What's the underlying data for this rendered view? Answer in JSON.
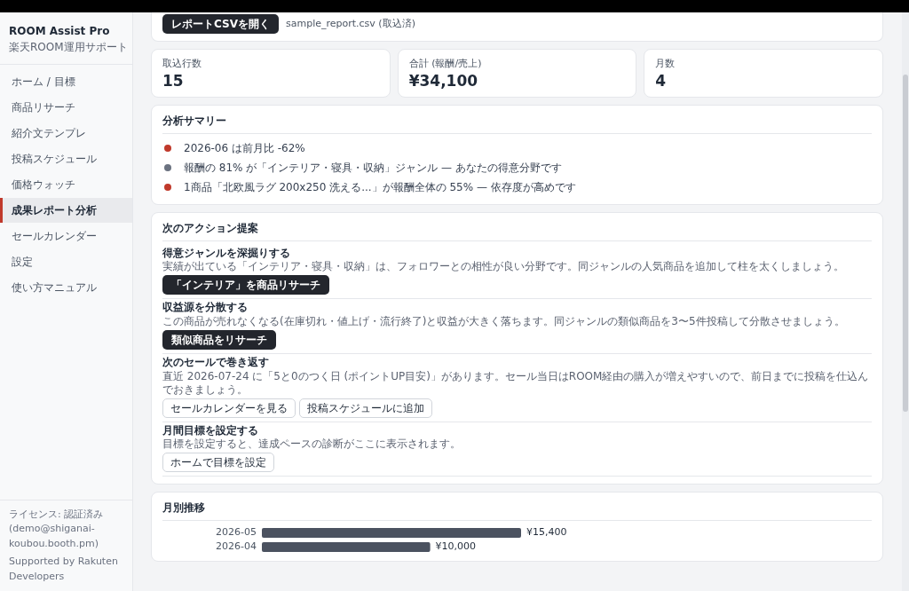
{
  "sidebar": {
    "app_title": "ROOM Assist Pro",
    "app_subtitle": "楽天ROOM運用サポート",
    "items": [
      {
        "label": "ホーム / 目標",
        "selected": false
      },
      {
        "label": "商品リサーチ",
        "selected": false
      },
      {
        "label": "紹介文テンプレ",
        "selected": false
      },
      {
        "label": "投稿スケジュール",
        "selected": false
      },
      {
        "label": "価格ウォッチ",
        "selected": false
      },
      {
        "label": "成果レポート分析",
        "selected": true
      },
      {
        "label": "セールカレンダー",
        "selected": false
      },
      {
        "label": "設定",
        "selected": false
      },
      {
        "label": "使い方マニュアル",
        "selected": false
      }
    ],
    "license": "ライセンス: 認証済み (demo@shiganai-koubou.booth.pm)",
    "credit": "Supported by Rakuten Developers"
  },
  "import_card": {
    "button": "レポートCSVを開く",
    "file": "sample_report.csv (取込済)"
  },
  "stats": [
    {
      "label": "取込行数",
      "value": "15"
    },
    {
      "label": "合計 (報酬/売上)",
      "value": "¥34,100"
    },
    {
      "label": "月数",
      "value": "4"
    }
  ],
  "summary": {
    "title": "分析サマリー",
    "items": [
      {
        "text": "2026-06 は前月比 -62%",
        "color": "#c0392b"
      },
      {
        "text": "報酬の 81% が「インテリア・寝具・収納」ジャンル — あなたの得意分野です",
        "color": "#6b7280"
      },
      {
        "text": "1商品「北欧風ラグ 200x250 洗える...」が報酬全体の 55% — 依存度が高めです",
        "color": "#c0392b"
      }
    ]
  },
  "actions": {
    "title": "次のアクション提案",
    "items": [
      {
        "heading": "得意ジャンルを深掘りする",
        "text": "実績が出ている「インテリア・寝具・収納」は、フォロワーとの相性が良い分野です。同ジャンルの人気商品を追加して柱を太くしましょう。",
        "buttons": [
          {
            "label": "「インテリア」を商品リサーチ",
            "kind": "primary"
          }
        ]
      },
      {
        "heading": "収益源を分散する",
        "text": "この商品が売れなくなる(在庫切れ・値上げ・流行終了)と収益が大きく落ちます。同ジャンルの類似商品を3〜5件投稿して分散させましょう。",
        "buttons": [
          {
            "label": "類似商品をリサーチ",
            "kind": "primary"
          }
        ]
      },
      {
        "heading": "次のセールで巻き返す",
        "text": "直近 2026-07-24 に「5と0のつく日 (ポイントUP目安)」があります。セール当日はROOM経由の購入が増えやすいので、前日までに投稿を仕込んでおきましょう。",
        "buttons": [
          {
            "label": "セールカレンダーを見る",
            "kind": "outline"
          },
          {
            "label": "投稿スケジュールに追加",
            "kind": "outline"
          }
        ]
      },
      {
        "heading": "月間目標を設定する",
        "text": "目標を設定すると、達成ペースの診断がここに表示されます。",
        "buttons": [
          {
            "label": "ホームで目標を設定",
            "kind": "outline"
          }
        ]
      }
    ]
  },
  "monthly": {
    "title": "月別推移",
    "chart_data": {
      "type": "bar",
      "orientation": "horizontal",
      "categories": [
        "2026-05",
        "2026-04"
      ],
      "values": [
        15400,
        10000
      ],
      "value_labels": [
        "¥15,400",
        "¥10,000"
      ]
    }
  }
}
